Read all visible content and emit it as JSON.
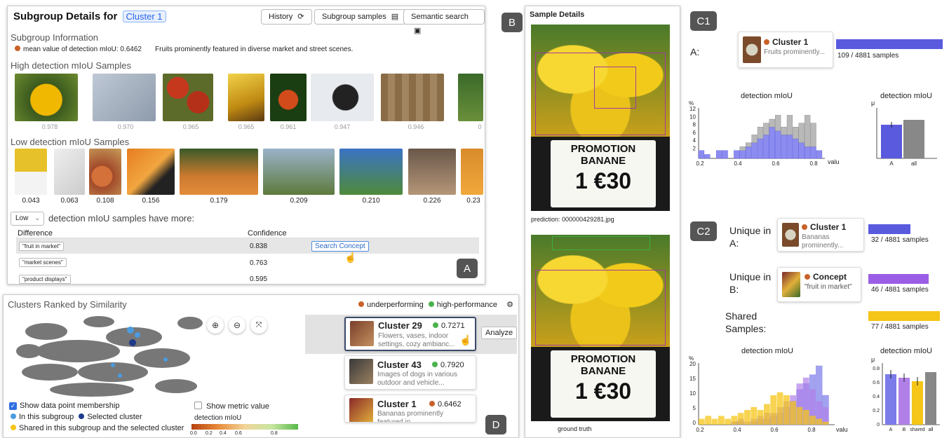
{
  "panelA": {
    "title": "Subgroup Details for",
    "cluster_chip": "Cluster 1",
    "buttons": {
      "history": "History",
      "samples": "Subgroup samples",
      "semantic": "Semantic search"
    },
    "info_heading": "Subgroup Information",
    "mean_text": "mean value of detection mIoU: 0.6462",
    "desc": "Fruits prominently featured in diverse market and street scenes.",
    "high_heading": "High detection mIoU Samples",
    "high_scores": [
      "0.978",
      "0.970",
      "0.965",
      "0.965",
      "0.961",
      "0.947",
      "0.946",
      "0"
    ],
    "low_heading": "Low detection mIoU Samples",
    "low_scores": [
      "0.043",
      "0.063",
      "0.108",
      "0.156",
      "0.179",
      "0.209",
      "0.210",
      "0.226",
      "0.23"
    ],
    "dropdown": "Low",
    "compare_text": "detection mIoU samples have more:",
    "col_diff": "Difference",
    "col_conf": "Confidence",
    "rows": [
      {
        "term": "\"fruit in market\"",
        "conf": "0.838"
      },
      {
        "term": "\"market scenes\"",
        "conf": "0.763"
      },
      {
        "term": "\"product displays\"",
        "conf": "0.595"
      }
    ],
    "search_concept": "Search Concept",
    "tag": "A"
  },
  "panelB": {
    "tag": "B",
    "title": "Sample Details",
    "sign_line1": "PROMOTION",
    "sign_line2": "BANANE",
    "sign_price": "1 €30",
    "prediction_caption": "prediction: 000000429281.jpg",
    "gt_caption": "ground truth"
  },
  "panelC1": {
    "tag": "C1",
    "a_label": "A:",
    "cluster_name": "Cluster 1",
    "cluster_desc": "Fruits prominently...",
    "count": "109 / 4881 samples",
    "hist_title": "detection mIoU",
    "bar_title": "detection mIoU",
    "pct": "%",
    "mu": "μ",
    "valu": "valu",
    "xticks": [
      "0.2",
      "0.4",
      "0.6",
      "0.8"
    ],
    "yticks": [
      "12",
      "10",
      "8",
      "6",
      "4",
      "2"
    ],
    "bar_cats": [
      "A",
      "all"
    ],
    "bar_yticks": [
      "0.8",
      "0.6",
      "0.4",
      "0.2"
    ]
  },
  "panelC2": {
    "tag": "C2",
    "unique_a": "Unique in A:",
    "unique_b": "Unique in B:",
    "shared": "Shared Samples:",
    "a_name": "Cluster 1",
    "a_desc": "Bananas prominently...",
    "a_count": "32 / 4881 samples",
    "b_name": "Concept",
    "b_desc": "\"fruit in market\"",
    "b_count": "46 / 4881 samples",
    "shared_count": "77 / 4881 samples",
    "hist_title": "detection mIoU",
    "bar_title": "detection mIoU",
    "yticks": [
      "20",
      "15",
      "10",
      "5",
      "0"
    ],
    "xticks": [
      "0.2",
      "0.4",
      "0.6",
      "0.8"
    ],
    "bar_cats": [
      "A",
      "B",
      "shared",
      "all"
    ],
    "bar_yticks": [
      "0.8",
      "0.6",
      "0.4",
      "0.2",
      "0"
    ]
  },
  "panelD": {
    "title": "Clusters Ranked by Similarity",
    "legend_under": "underperforming",
    "legend_high": "high-performance",
    "show_membership": "Show data point membership",
    "in_subgroup": "In this subgroup",
    "selected_cluster": "Selected cluster",
    "shared_text": "Shared in this subgroup and the selected cluster",
    "show_metric": "Show metric value",
    "metric_label": "detection mIoU",
    "metric_ticks": [
      "0.0",
      "0.2",
      "0.4",
      "0.6",
      "0.8"
    ],
    "analyze": "Analyze",
    "clusters": [
      {
        "name": "Cluster 29",
        "score": "0.7271",
        "desc": "Flowers, vases, indoor settings, cozy ambianc..."
      },
      {
        "name": "Cluster 43",
        "score": "0.7920",
        "desc": "Images of dogs in various outdoor and vehicle..."
      },
      {
        "name": "Cluster 1",
        "score": "0.6462",
        "desc": "Bananas prominently featured in..."
      }
    ],
    "tag": "D"
  },
  "colors": {
    "under": "#c8622a",
    "high": "#4cb24f",
    "blue": "#5a5adf",
    "purple": "#9b5de5",
    "yellow": "#f5c518",
    "chip": "#3b82f6"
  }
}
